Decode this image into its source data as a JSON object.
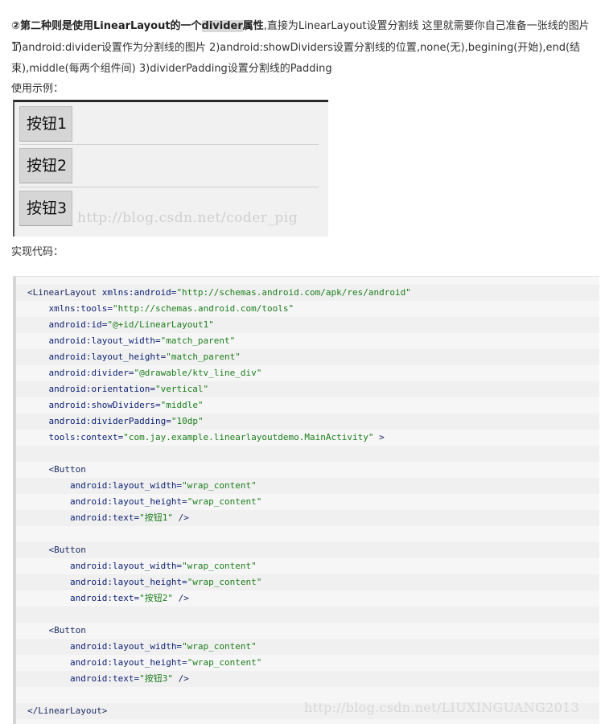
{
  "intro": {
    "bold_lead": "②第二种则是使用LinearLayout的一个",
    "highlight": "divider",
    "bold_tail": "属性",
    "line1_rest": ",直接为LinearLayout设置分割线 这里就需要你自己准备一张线的图片了",
    "line2": "1)android:divider设置作为分割线的图片 2)android:showDividers设置分割线的位置,none(无),begining(开始),end(结",
    "line3": "束),middle(每两个组件间) 3)dividerPadding设置分割线的Padding",
    "example_label": "使用示例："
  },
  "demo": {
    "buttons": [
      "按钮1",
      "按钮2",
      "按钮3"
    ],
    "watermark": "http://blog.csdn.net/coder_pig"
  },
  "code_label": "实现代码：",
  "code": {
    "lines": [
      {
        "indent": "",
        "tag": "<LinearLayout",
        "attr": " xmlns:android=",
        "val": "\"http://schemas.android.com/apk/res/android\"",
        "end": ""
      },
      {
        "indent": "    ",
        "tag": "",
        "attr": "xmlns:tools=",
        "val": "\"http://schemas.android.com/tools\"",
        "end": ""
      },
      {
        "indent": "    ",
        "tag": "",
        "attr": "android:id=",
        "val": "\"@+id/LinearLayout1\"",
        "end": ""
      },
      {
        "indent": "    ",
        "tag": "",
        "attr": "android:layout_width=",
        "val": "\"match_parent\"",
        "end": ""
      },
      {
        "indent": "    ",
        "tag": "",
        "attr": "android:layout_height=",
        "val": "\"match_parent\"",
        "end": ""
      },
      {
        "indent": "    ",
        "tag": "",
        "attr": "android:divider=",
        "val": "\"@drawable/ktv_line_div\"",
        "end": ""
      },
      {
        "indent": "    ",
        "tag": "",
        "attr": "android:orientation=",
        "val": "\"vertical\"",
        "end": ""
      },
      {
        "indent": "    ",
        "tag": "",
        "attr": "android:showDividers=",
        "val": "\"middle\"",
        "end": ""
      },
      {
        "indent": "    ",
        "tag": "",
        "attr": "android:dividerPadding=",
        "val": "\"10dp\"",
        "end": ""
      },
      {
        "indent": "    ",
        "tag": "",
        "attr": "tools:context=",
        "val": "\"com.jay.example.linearlayoutdemo.MainActivity\"",
        "end": " >"
      },
      {
        "indent": "",
        "tag": "",
        "attr": "",
        "val": "",
        "end": ""
      },
      {
        "indent": "    ",
        "tag": "<Button",
        "attr": "",
        "val": "",
        "end": ""
      },
      {
        "indent": "        ",
        "tag": "",
        "attr": "android:layout_width=",
        "val": "\"wrap_content\"",
        "end": ""
      },
      {
        "indent": "        ",
        "tag": "",
        "attr": "android:layout_height=",
        "val": "\"wrap_content\"",
        "end": ""
      },
      {
        "indent": "        ",
        "tag": "",
        "attr": "android:text=",
        "val": "\"按钮1\"",
        "end": " />"
      },
      {
        "indent": "",
        "tag": "",
        "attr": "",
        "val": "",
        "end": ""
      },
      {
        "indent": "    ",
        "tag": "<Button",
        "attr": "",
        "val": "",
        "end": ""
      },
      {
        "indent": "        ",
        "tag": "",
        "attr": "android:layout_width=",
        "val": "\"wrap_content\"",
        "end": ""
      },
      {
        "indent": "        ",
        "tag": "",
        "attr": "android:layout_height=",
        "val": "\"wrap_content\"",
        "end": ""
      },
      {
        "indent": "        ",
        "tag": "",
        "attr": "android:text=",
        "val": "\"按钮2\"",
        "end": " />"
      },
      {
        "indent": "",
        "tag": "",
        "attr": "",
        "val": "",
        "end": ""
      },
      {
        "indent": "    ",
        "tag": "<Button",
        "attr": "",
        "val": "",
        "end": ""
      },
      {
        "indent": "        ",
        "tag": "",
        "attr": "android:layout_width=",
        "val": "\"wrap_content\"",
        "end": ""
      },
      {
        "indent": "        ",
        "tag": "",
        "attr": "android:layout_height=",
        "val": "\"wrap_content\"",
        "end": ""
      },
      {
        "indent": "        ",
        "tag": "",
        "attr": "android:text=",
        "val": "\"按钮3\"",
        "end": " />"
      },
      {
        "indent": "",
        "tag": "",
        "attr": "",
        "val": "",
        "end": ""
      },
      {
        "indent": "",
        "tag": "</LinearLayout>",
        "attr": "",
        "val": "",
        "end": ""
      }
    ],
    "watermark": "http://blog.csdn.net/LIUXINGUANG2013"
  }
}
